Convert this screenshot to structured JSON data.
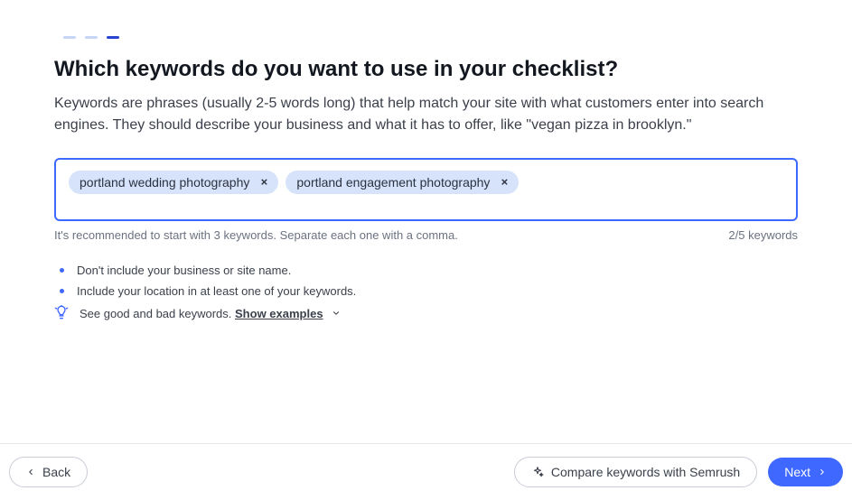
{
  "heading": "Which keywords do you want to use in your checklist?",
  "description": "Keywords are phrases (usually 2-5 words long) that help match your site with what customers enter into search engines. They should describe your business and what it has to offer, like \"vegan pizza in brooklyn.\"",
  "keywords": [
    "portland wedding photography",
    "portland engagement photography"
  ],
  "hint_left": "It's recommended to start with 3 keywords. Separate each one with a comma.",
  "hint_right": "2/5 keywords",
  "tips": {
    "tip1": "Don't include your business or site name.",
    "tip2": "Include your location in at least one of your keywords.",
    "tip3_prefix": "See good and bad keywords. ",
    "show_examples": "Show examples"
  },
  "footer": {
    "back": "Back",
    "compare": "Compare keywords with Semrush",
    "next": "Next"
  }
}
